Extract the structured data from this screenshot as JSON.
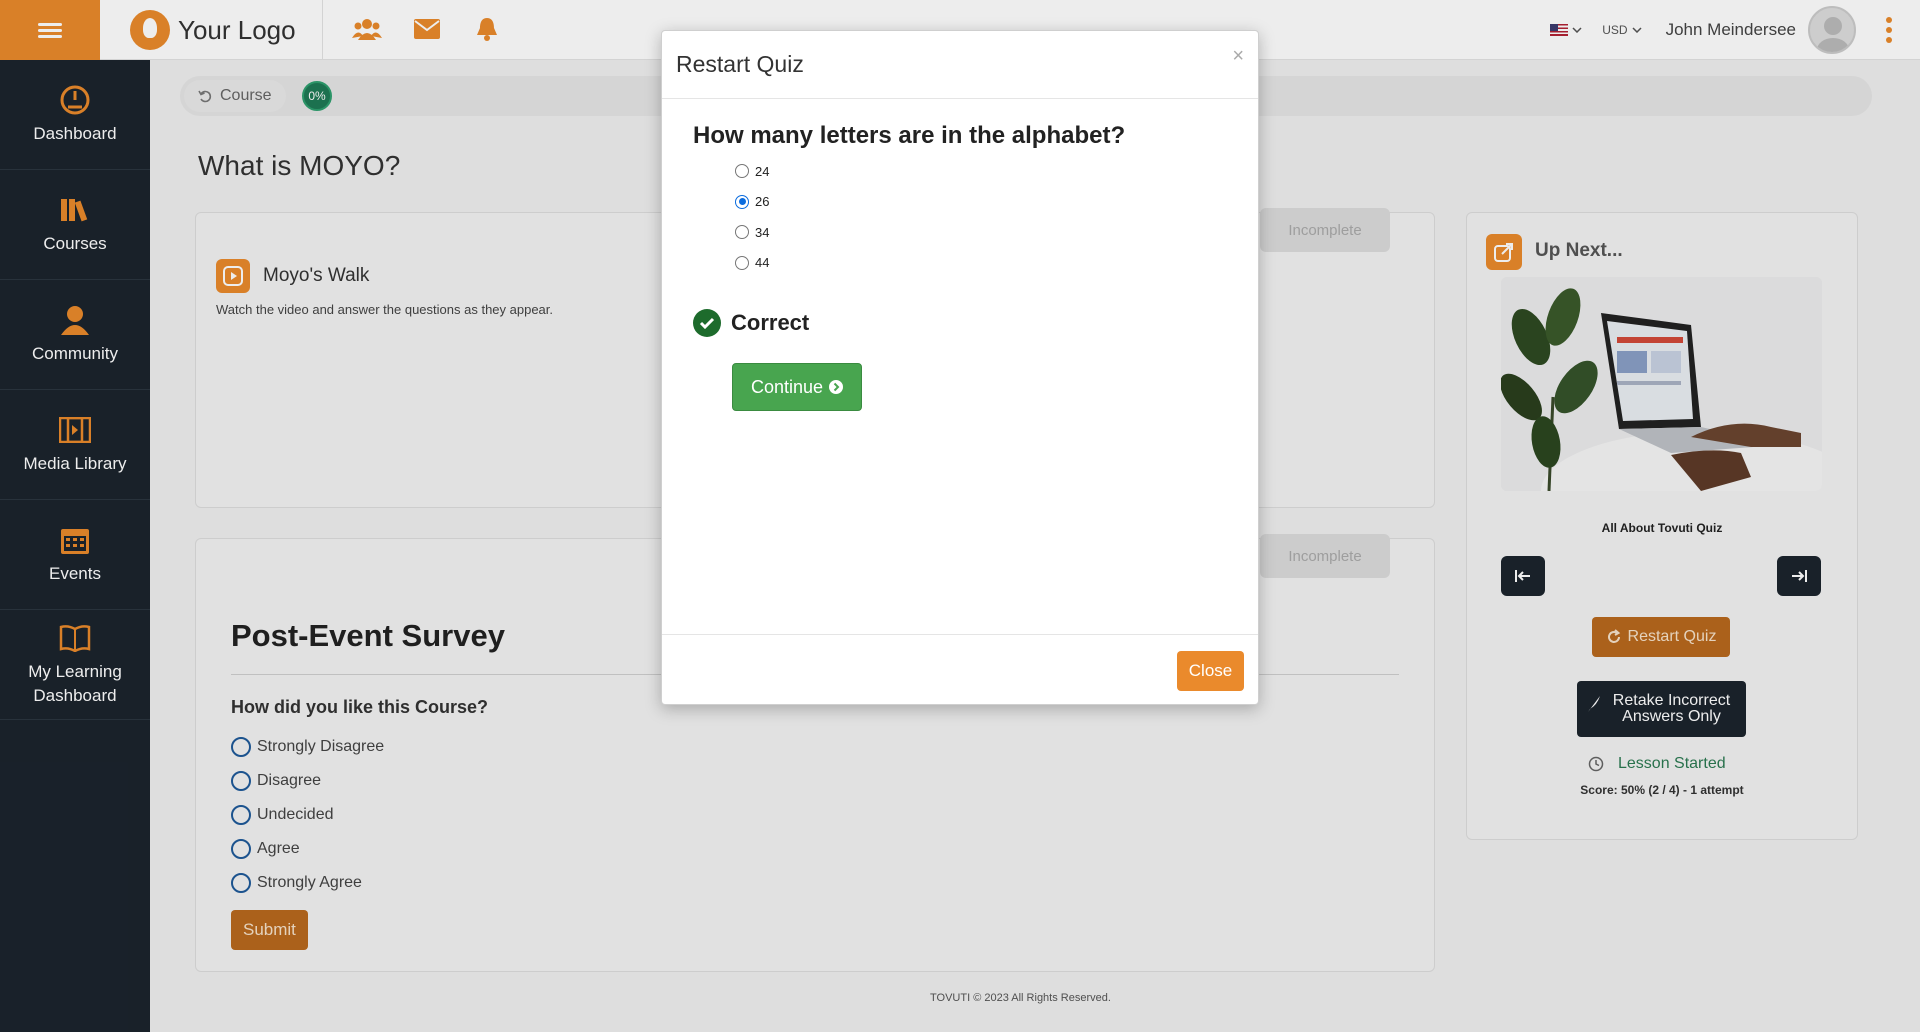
{
  "topbar": {
    "logo_text": "Your Logo",
    "currency": "USD",
    "user_name": "John Meindersee",
    "icons": [
      "menu-icon",
      "users-icon",
      "envelope-icon",
      "bell-icon"
    ],
    "accent_color": "#ea8a2c"
  },
  "sidebar": {
    "items": [
      {
        "label": "Dashboard",
        "icon": "dashboard-icon"
      },
      {
        "label": "Courses",
        "icon": "books-icon"
      },
      {
        "label": "Community",
        "icon": "community-icon"
      },
      {
        "label": "Media Library",
        "icon": "film-icon"
      },
      {
        "label": "Events",
        "icon": "calendar-icon"
      },
      {
        "label": "My Learning Dashboard",
        "icon": "open-book-icon"
      }
    ]
  },
  "course_nav": {
    "course_label": "Course",
    "progress": "0%"
  },
  "page": {
    "title": "What is MOYO?",
    "video_card": {
      "title": "Moyo's Walk",
      "description": "Watch the video and answer the questions as they appear.",
      "status": "Incomplete"
    },
    "survey_card": {
      "status": "Incomplete",
      "title": "Post-Event Survey",
      "question": "How did you like this Course?",
      "options": [
        "Strongly Disagree",
        "Disagree",
        "Undecided",
        "Agree",
        "Strongly Agree"
      ],
      "submit_label": "Submit"
    },
    "footer": "TOVUTI © 2023 All Rights Reserved."
  },
  "up_next": {
    "title": "Up Next...",
    "caption": "All About Tovuti Quiz",
    "restart_label": "Restart Quiz",
    "retake_label": "Retake Incorrect Answers Only",
    "lesson_status": "Lesson Started",
    "score": "Score: 50% (2 / 4) - 1 attempt"
  },
  "modal": {
    "title": "Restart Quiz",
    "close_x": "×",
    "question": "How many letters are in the alphabet?",
    "options": [
      "24",
      "26",
      "34",
      "44"
    ],
    "selected": "26",
    "result": "Correct",
    "continue_label": "Continue",
    "close_label": "Close"
  }
}
